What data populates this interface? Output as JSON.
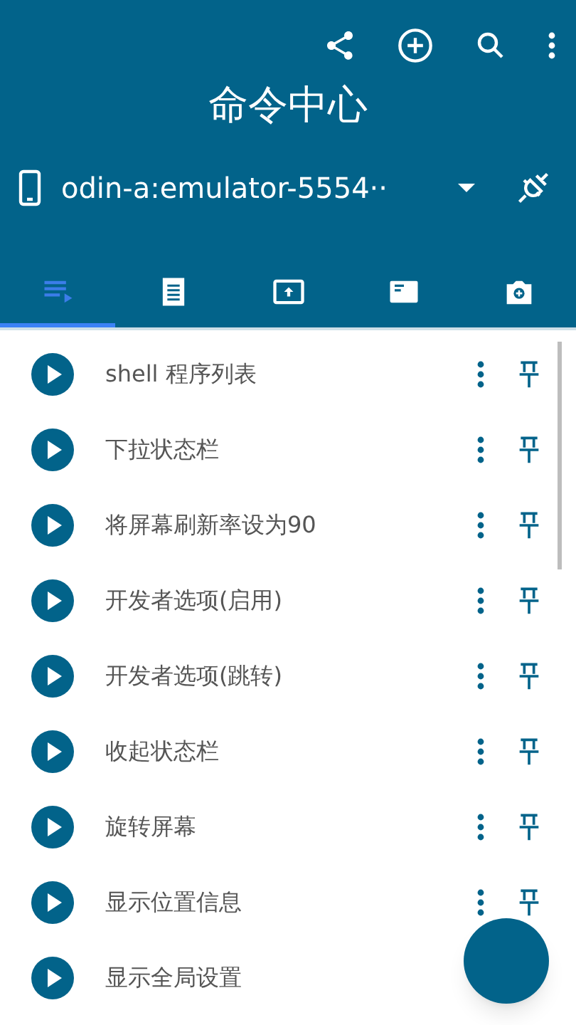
{
  "app_bar": {
    "title": "命令中心"
  },
  "device": {
    "name": "odin-a:emulator-5554··"
  },
  "tabs": [
    {
      "kind": "list",
      "selected": true
    },
    {
      "kind": "receipt",
      "selected": false
    },
    {
      "kind": "upload",
      "selected": false
    },
    {
      "kind": "card",
      "selected": false
    },
    {
      "kind": "camera",
      "selected": false
    }
  ],
  "commands": [
    {
      "label": "shell 程序列表"
    },
    {
      "label": "下拉状态栏"
    },
    {
      "label": "将屏幕刷新率设为90"
    },
    {
      "label": "开发者选项(启用)"
    },
    {
      "label": "开发者选项(跳转)"
    },
    {
      "label": "收起状态栏"
    },
    {
      "label": "旋转屏幕"
    },
    {
      "label": "显示位置信息"
    },
    {
      "label": "显示全局设置"
    }
  ]
}
